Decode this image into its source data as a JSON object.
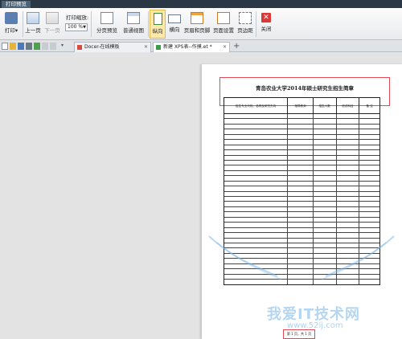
{
  "window": {
    "tab_title": "打印预览"
  },
  "ribbon": {
    "print": "打印",
    "print_arrow": "▾",
    "prev_page": "上一页",
    "next_page": "下一页",
    "zoom_label": "打印缩放:",
    "zoom_value": "100 %",
    "split_preview": "分页预览",
    "normal_view": "普通视图",
    "portrait": "纵向",
    "landscape": "横向",
    "header_footer": "页眉和页脚",
    "page_setup": "页面设置",
    "margins": "页边距",
    "close": "关闭",
    "close_glyph": "✕"
  },
  "tabs": [
    {
      "label": "Docer-在线模板",
      "active": false
    },
    {
      "label": "新建 XPS表--作摸.et *",
      "active": true
    }
  ],
  "tab_close": "✕",
  "tab_add": "+",
  "document": {
    "title": "青岛农业大学2014年硕士研究生招生简章",
    "columns": [
      "招生专业代码、名称及研究方向",
      "指导教师",
      "招生人数",
      "初试科目",
      "备 注"
    ],
    "row_count": 33,
    "page_number": "第 1 页，共 1 页"
  },
  "watermark": {
    "text": "我爱IT技术网",
    "url": "www.52ij.com"
  },
  "colors": {
    "highlight_box": "#e34a55",
    "ribbon_active": "#ffe9a8",
    "title_strip": "#2a3845"
  }
}
